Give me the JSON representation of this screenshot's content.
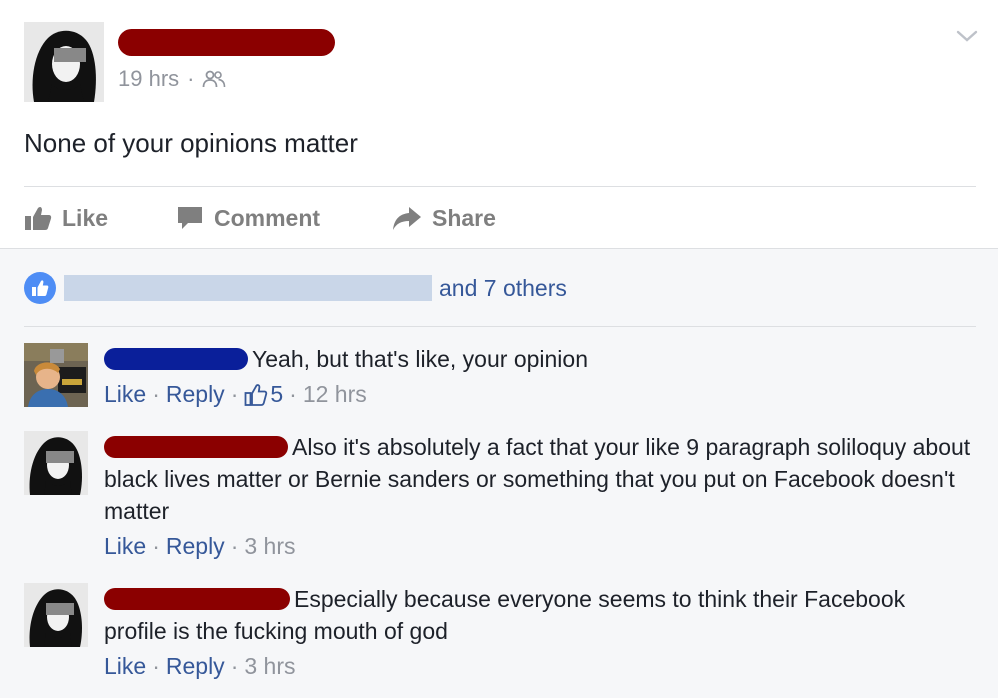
{
  "post": {
    "time": "19 hrs",
    "separator": "·",
    "audience_icon": "friends-icon",
    "text": "None of your opinions matter",
    "actions": {
      "like": "Like",
      "comment": "Comment",
      "share": "Share"
    }
  },
  "likes": {
    "others": "and 7 others"
  },
  "comments": [
    {
      "text": "Yeah, but that's like, your opinion",
      "like": "Like",
      "reply": "Reply",
      "reactions": "5",
      "time": "12 hrs"
    },
    {
      "text": "Also it's absolutely a fact that your like 9 paragraph soliloquy about black lives matter or Bernie sanders or something that you put on Facebook doesn't matter",
      "like": "Like",
      "reply": "Reply",
      "time": "3 hrs"
    },
    {
      "text": "Especially because everyone seems to think their Facebook profile is the fucking mouth of god",
      "like": "Like",
      "reply": "Reply",
      "time": "3 hrs"
    }
  ],
  "separator": "·",
  "colors": {
    "link": "#365899",
    "meta": "#90949c",
    "redact_red": "#8b0000",
    "redact_blue": "#0a1f9a",
    "like_badge": "#4e8df5"
  }
}
